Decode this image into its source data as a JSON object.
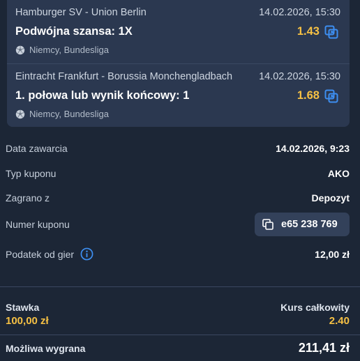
{
  "events": [
    {
      "match": "Hamburger SV - Union Berlin",
      "datetime": "14.02.2026, 15:30",
      "pick": "Podwójna szansa: 1X",
      "odds": "1.43",
      "league": "Niemcy, Bundesliga"
    },
    {
      "match": "Eintracht Frankfurt - Borussia Monchengladbach",
      "datetime": "14.02.2026, 15:30",
      "pick": "1. połowa lub wynik końcowy: 1",
      "odds": "1.68",
      "league": "Niemcy, Bundesliga"
    }
  ],
  "details": {
    "date_label": "Data zawarcia",
    "date_value": "14.02.2026, 9:23",
    "type_label": "Typ kuponu",
    "type_value": "AKO",
    "source_label": "Zagrano z",
    "source_value": "Depozyt",
    "coupon_label": "Numer kuponu",
    "coupon_value": "e65 238 769",
    "tax_label": "Podatek od gier",
    "tax_value": "12,00 zł"
  },
  "summary": {
    "stake_label": "Stawka",
    "stake_value": "100,00 zł",
    "total_odds_label": "Kurs całkowity",
    "total_odds_value": "2.40",
    "win_label": "Możliwa wygrana",
    "win_value": "211,41 zł"
  },
  "icons": {
    "swap": "swap-icon",
    "league": "soccer-ball-icon",
    "copy": "copy-icon",
    "info": "info-icon"
  },
  "colors": {
    "background": "#1c2636",
    "card": "#2b3850",
    "odds_accent": "#f5c044",
    "icon_accent": "#3d8ef0"
  }
}
